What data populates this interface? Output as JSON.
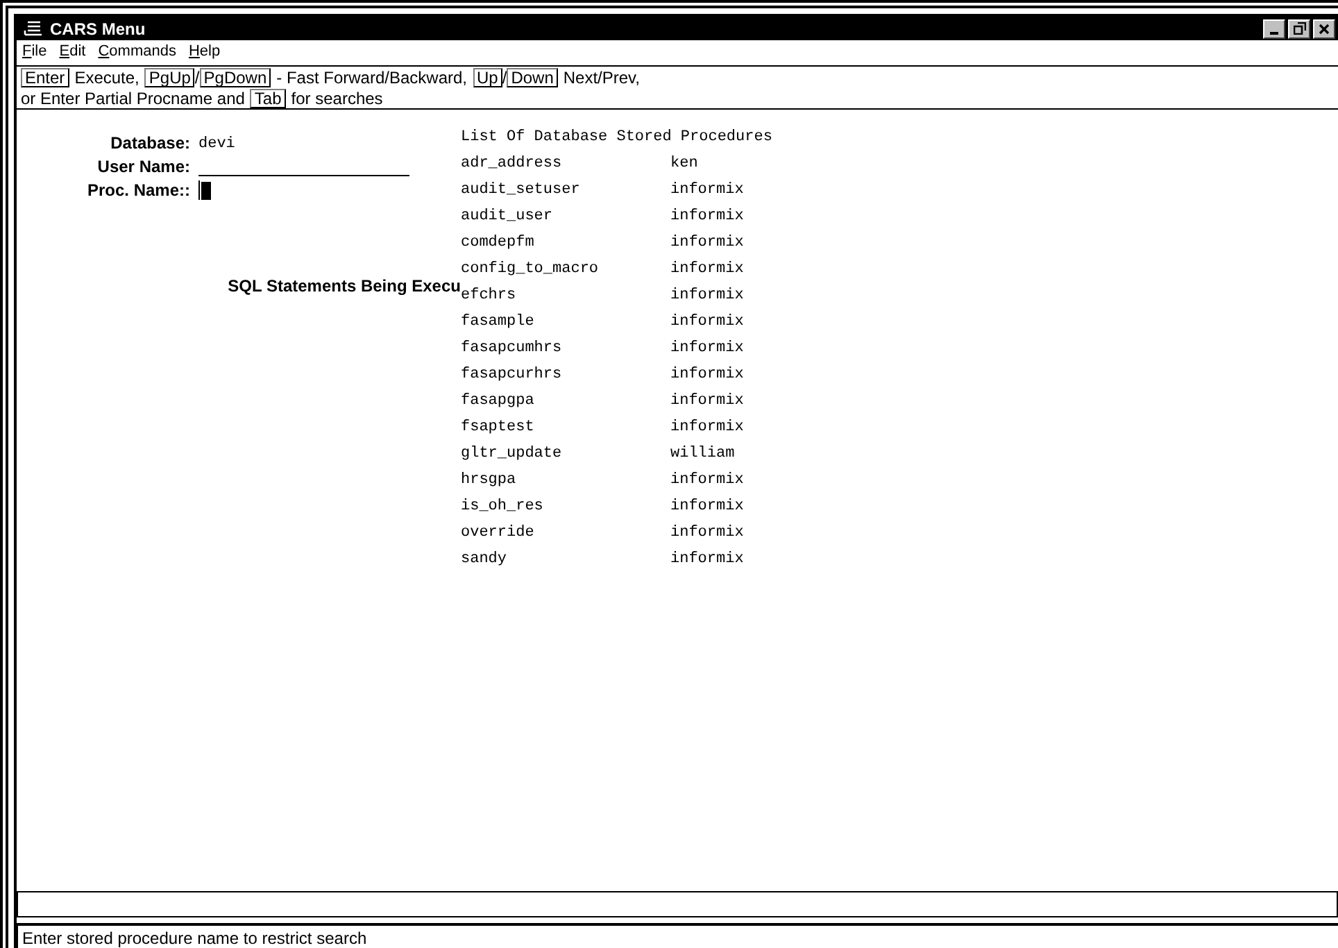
{
  "window": {
    "title": "CARS Menu"
  },
  "menu": [
    {
      "label": "File"
    },
    {
      "label": "Edit"
    },
    {
      "label": "Commands"
    },
    {
      "label": "Help"
    }
  ],
  "hints": [
    [
      {
        "kind": "key",
        "text": "Enter"
      },
      {
        "kind": "text",
        "text": "Execute,"
      },
      {
        "kind": "key",
        "text": "PgUp"
      },
      {
        "kind": "sep",
        "text": "/"
      },
      {
        "kind": "key",
        "text": "PgDown"
      },
      {
        "kind": "text",
        "text": "- Fast Forward/Backward,"
      },
      {
        "kind": "key",
        "text": "Up"
      },
      {
        "kind": "sep",
        "text": "/"
      },
      {
        "kind": "key",
        "text": "Down"
      },
      {
        "kind": "text",
        "text": "Next/Prev,"
      }
    ],
    [
      {
        "kind": "text",
        "text": "or Enter Partial Procname and"
      },
      {
        "kind": "key",
        "text": "Tab"
      },
      {
        "kind": "text",
        "text": "for searches"
      }
    ]
  ],
  "form": {
    "database_label": "Database:",
    "database": "devi",
    "user_label": "User Name:",
    "proc_label": "Proc. Name::",
    "sql_heading": "SQL Statements Being Execu"
  },
  "procedures": {
    "title": "List Of Database Stored Procedures",
    "rows": [
      {
        "name": "adr_address",
        "owner": "ken"
      },
      {
        "name": "audit_setuser",
        "owner": "informix"
      },
      {
        "name": "audit_user",
        "owner": "informix"
      },
      {
        "name": "comdepfm",
        "owner": "informix"
      },
      {
        "name": "config_to_macro",
        "owner": "informix"
      },
      {
        "name": "efchrs",
        "owner": "informix"
      },
      {
        "name": "fasample",
        "owner": "informix"
      },
      {
        "name": "fasapcumhrs",
        "owner": "informix"
      },
      {
        "name": "fasapcurhrs",
        "owner": "informix"
      },
      {
        "name": "fasapgpa",
        "owner": "informix"
      },
      {
        "name": "fsaptest",
        "owner": "informix"
      },
      {
        "name": "gltr_update",
        "owner": "william"
      },
      {
        "name": "hrsgpa",
        "owner": "informix"
      },
      {
        "name": "is_oh_res",
        "owner": "informix"
      },
      {
        "name": "override",
        "owner": "informix"
      },
      {
        "name": "sandy",
        "owner": "informix"
      }
    ]
  },
  "status_bar": "Enter stored procedure name to restrict search"
}
